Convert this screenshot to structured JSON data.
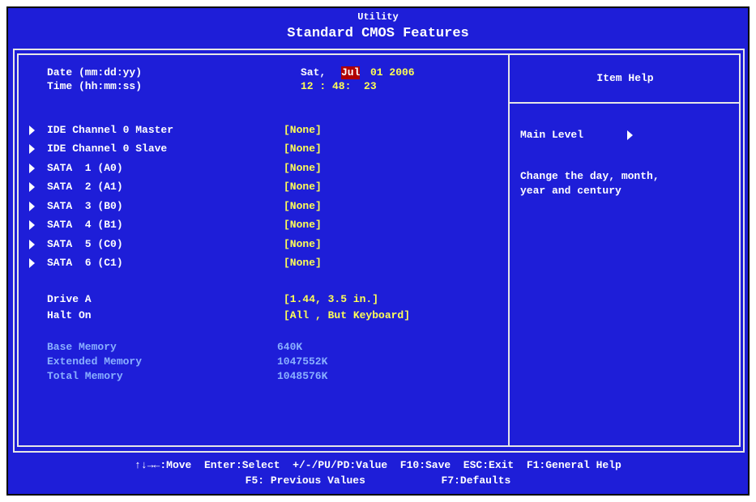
{
  "header": {
    "utility": "Utility",
    "title": "Standard CMOS Features"
  },
  "datetime": {
    "date_label": "Date (mm:dd:yy)",
    "date_day": "Sat,",
    "date_month": "Jul",
    "date_rest": "01 2006",
    "time_label": "Time (hh:mm:ss)",
    "time_value": "12 : 48:  23"
  },
  "submenus": [
    {
      "label": "IDE Channel 0 Master",
      "value": "[None]"
    },
    {
      "label": "IDE Channel 0 Slave",
      "value": "[None]"
    },
    {
      "label": "SATA  1 (A0)",
      "value": "[None]"
    },
    {
      "label": "SATA  2 (A1)",
      "value": "[None]"
    },
    {
      "label": "SATA  3 (B0)",
      "value": "[None]"
    },
    {
      "label": "SATA  4 (B1)",
      "value": "[None]"
    },
    {
      "label": "SATA  5 (C0)",
      "value": "[None]"
    },
    {
      "label": "SATA  6 (C1)",
      "value": "[None]"
    }
  ],
  "options": [
    {
      "label": "Drive A",
      "value": "[1.44, 3.5 in.]"
    },
    {
      "label": "Halt On",
      "value": "[All , But Keyboard]"
    }
  ],
  "memory": [
    {
      "label": "Base Memory",
      "value": "640K"
    },
    {
      "label": "Extended Memory",
      "value": "1047552K"
    },
    {
      "label": "Total Memory",
      "value": "1048576K"
    }
  ],
  "help": {
    "title": "Item Help",
    "level": "Main Level",
    "text1": "Change the day, month,",
    "text2": "year and century"
  },
  "footer": {
    "line1": "↑↓→←:Move  Enter:Select  +/-/PU/PD:Value  F10:Save  ESC:Exit  F1:General Help",
    "line2": "F5: Previous Values            F7:Defaults"
  },
  "colors": {
    "background": "#1e1ed8",
    "value": "#ffff55",
    "highlight": "#b00000",
    "dim_text": "#8ab0ff"
  }
}
